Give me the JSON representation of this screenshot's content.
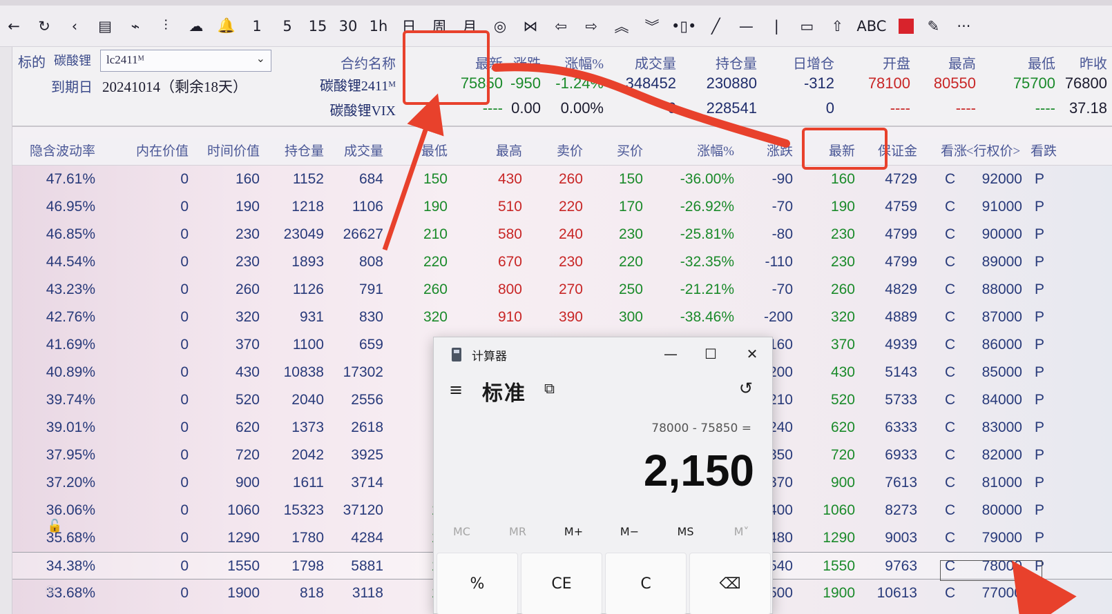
{
  "toolbar": {
    "items": [
      {
        "icon": "back-arrow-icon",
        "glyph": "←"
      },
      {
        "icon": "refresh-icon",
        "glyph": "↻"
      },
      {
        "icon": "chevron-left-icon",
        "glyph": "‹"
      },
      {
        "icon": "grid-icon",
        "glyph": "▤"
      },
      {
        "icon": "line-chart-icon",
        "glyph": "⌁"
      },
      {
        "icon": "candlestick-icon",
        "glyph": "⫶"
      },
      {
        "icon": "cloud-icon",
        "glyph": "☁"
      },
      {
        "icon": "bell-icon",
        "glyph": "🔔"
      },
      {
        "icon": "period-1-icon",
        "glyph": "1"
      },
      {
        "icon": "period-5-icon",
        "glyph": "5"
      },
      {
        "icon": "period-15-icon",
        "glyph": "15"
      },
      {
        "icon": "period-30-icon",
        "glyph": "30"
      },
      {
        "icon": "period-1h-icon",
        "glyph": "1h"
      },
      {
        "icon": "period-day-icon",
        "glyph": "日"
      },
      {
        "icon": "period-week-icon",
        "glyph": "周"
      },
      {
        "icon": "period-month-icon",
        "glyph": "月"
      },
      {
        "icon": "globe-icon",
        "glyph": "◎"
      },
      {
        "icon": "bowtie-icon",
        "glyph": "⋈"
      },
      {
        "icon": "arrow-left-icon",
        "glyph": "⇦"
      },
      {
        "icon": "arrow-right-icon",
        "glyph": "⇨"
      },
      {
        "icon": "double-up-icon",
        "glyph": "︽"
      },
      {
        "icon": "double-down-icon",
        "glyph": "︾"
      },
      {
        "icon": "split-icon",
        "glyph": "•▯•"
      },
      {
        "icon": "diagonal-line-icon",
        "glyph": "╱"
      },
      {
        "icon": "horizontal-line-icon",
        "glyph": "—"
      },
      {
        "icon": "vertical-line-icon",
        "glyph": "|"
      },
      {
        "icon": "rectangle-icon",
        "glyph": "▭"
      },
      {
        "icon": "up-arrow-outline-icon",
        "glyph": "⇧"
      },
      {
        "icon": "abc-text-icon",
        "glyph": "ABC"
      },
      {
        "icon": "color-swatch-icon",
        "glyph": ""
      },
      {
        "icon": "pen-icon",
        "glyph": "✎"
      },
      {
        "icon": "more-icon",
        "glyph": "···"
      }
    ]
  },
  "info": {
    "underlying_label": "标的",
    "underlying_name": "碳酸锂",
    "contract_select_value": "lc2411ᴹ",
    "expiry_label": "到期日",
    "expiry_value": "20241014（剩余18天）",
    "headers": [
      "合约名称",
      "最新",
      "涨跌",
      "涨幅%",
      "成交量",
      "持仓量",
      "日增仓",
      "开盘",
      "最高",
      "最低",
      "昨收"
    ],
    "row1": {
      "name": "碳酸锂2411ᴹ",
      "latest": "75850",
      "change": "-950",
      "change_pct": "-1.24%",
      "volume": "348452",
      "open_interest": "230880",
      "oi_change": "-312",
      "open": "78100",
      "high": "80550",
      "low": "75700",
      "prev_close": "76800"
    },
    "row2": {
      "name": "碳酸锂VIX",
      "latest": "----",
      "change": "0.00",
      "change_pct": "0.00%",
      "volume": "0",
      "open_interest": "228541",
      "oi_change": "0",
      "open": "----",
      "high": "----",
      "low": "----",
      "prev_close": "37.18"
    }
  },
  "table": {
    "headers": [
      "隐含波动率",
      "内在价值",
      "时间价值",
      "持仓量",
      "成交量",
      "最低",
      "最高",
      "卖价",
      "买价",
      "涨幅%",
      "涨跌",
      "最新",
      "保证金",
      "看涨",
      "<行权价>",
      "看跌"
    ],
    "rows": [
      [
        "47.61%",
        "0",
        "160",
        "1152",
        "684",
        "150",
        "430",
        "260",
        "150",
        "-36.00%",
        "-90",
        "160",
        "4729",
        "C",
        "92000",
        "P"
      ],
      [
        "46.95%",
        "0",
        "190",
        "1218",
        "1106",
        "190",
        "510",
        "220",
        "170",
        "-26.92%",
        "-70",
        "190",
        "4759",
        "C",
        "91000",
        "P"
      ],
      [
        "46.85%",
        "0",
        "230",
        "23049",
        "26627",
        "210",
        "580",
        "240",
        "230",
        "-25.81%",
        "-80",
        "230",
        "4799",
        "C",
        "90000",
        "P"
      ],
      [
        "44.54%",
        "0",
        "230",
        "1893",
        "808",
        "220",
        "670",
        "230",
        "220",
        "-32.35%",
        "-110",
        "230",
        "4799",
        "C",
        "89000",
        "P"
      ],
      [
        "43.23%",
        "0",
        "260",
        "1126",
        "791",
        "260",
        "800",
        "270",
        "250",
        "-21.21%",
        "-70",
        "260",
        "4829",
        "C",
        "88000",
        "P"
      ],
      [
        "42.76%",
        "0",
        "320",
        "931",
        "830",
        "320",
        "910",
        "390",
        "300",
        "-38.46%",
        "-200",
        "320",
        "4889",
        "C",
        "87000",
        "P"
      ],
      [
        "41.69%",
        "0",
        "370",
        "1100",
        "659",
        "3",
        "",
        "",
        "",
        "",
        "160",
        "370",
        "4939",
        "C",
        "86000",
        "P"
      ],
      [
        "40.89%",
        "0",
        "430",
        "10838",
        "17302",
        "4",
        "",
        "",
        "",
        "",
        "200",
        "430",
        "5143",
        "C",
        "85000",
        "P"
      ],
      [
        "39.74%",
        "0",
        "520",
        "2040",
        "2556",
        "5",
        "",
        "",
        "",
        "",
        "210",
        "520",
        "5733",
        "C",
        "84000",
        "P"
      ],
      [
        "39.01%",
        "0",
        "620",
        "1373",
        "2618",
        "5",
        "",
        "",
        "",
        "",
        "240",
        "620",
        "6333",
        "C",
        "83000",
        "P"
      ],
      [
        "37.95%",
        "0",
        "720",
        "2042",
        "3925",
        "6",
        "",
        "",
        "",
        "",
        "350",
        "720",
        "6933",
        "C",
        "82000",
        "P"
      ],
      [
        "37.20%",
        "0",
        "900",
        "1611",
        "3714",
        "8",
        "",
        "",
        "",
        "",
        "370",
        "900",
        "7613",
        "C",
        "81000",
        "P"
      ],
      [
        "36.06%",
        "0",
        "1060",
        "15323",
        "37120",
        "10",
        "",
        "",
        "",
        "",
        "400",
        "1060",
        "8273",
        "C",
        "80000",
        "P"
      ],
      [
        "35.68%",
        "0",
        "1290",
        "1780",
        "4284",
        "12",
        "",
        "",
        "",
        "",
        "480",
        "1290",
        "9003",
        "C",
        "79000",
        "P"
      ],
      [
        "34.38%",
        "0",
        "1550",
        "1798",
        "5881",
        "15",
        "",
        "",
        "",
        "",
        "540",
        "1550",
        "9763",
        "C",
        "78000",
        "P"
      ],
      [
        "33.68%",
        "0",
        "1900",
        "818",
        "3118",
        "18",
        "",
        "",
        "",
        "",
        "500",
        "1900",
        "10613",
        "C",
        "77000",
        "P"
      ]
    ]
  },
  "calculator": {
    "title": "计算器",
    "mode": "标准",
    "keep_on_top_glyph": "⧉",
    "history_glyph": "↺",
    "menu_glyph": "≡",
    "minimize_glyph": "—",
    "maximize_glyph": "☐",
    "close_glyph": "✕",
    "expression": "78000 - 75850 =",
    "result": "2,150",
    "memory_buttons": [
      "MC",
      "MR",
      "M+",
      "M−",
      "MS",
      "M˅"
    ],
    "keys": [
      "%",
      "CE",
      "C",
      "⌫"
    ]
  },
  "colors": {
    "accent_annotation": "#e8412c",
    "up_red": "#c82626",
    "down_green": "#1a8a2a",
    "text_blue": "#283a7a"
  }
}
